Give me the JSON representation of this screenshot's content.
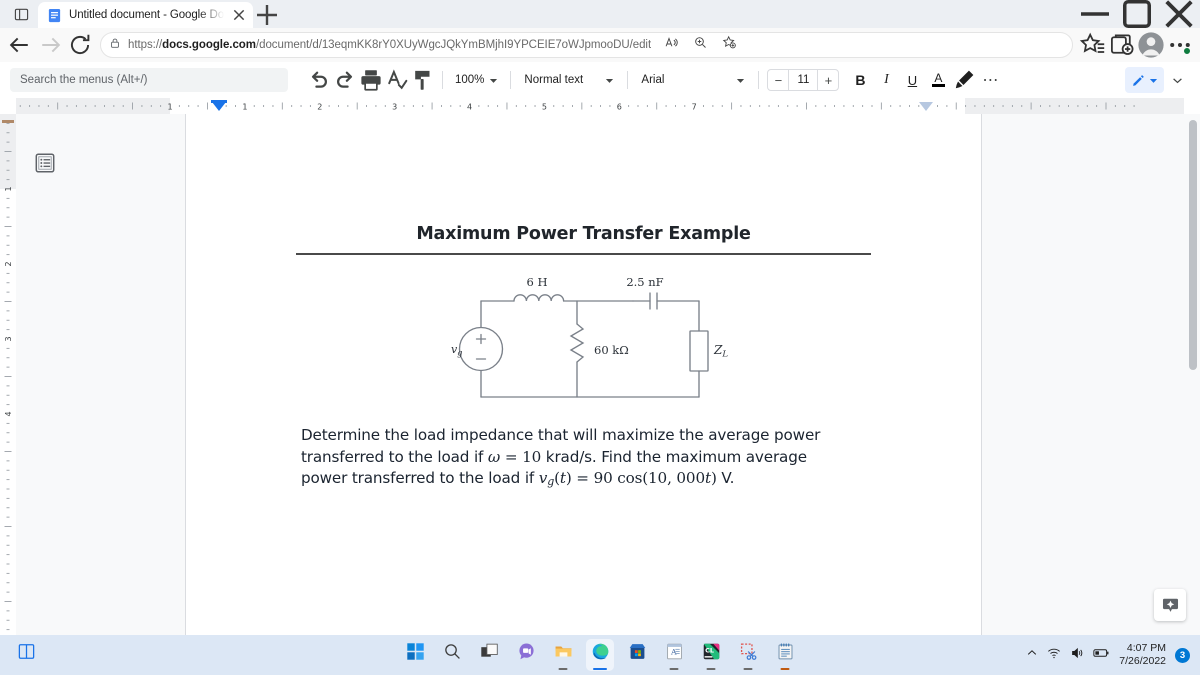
{
  "browser": {
    "tab": {
      "title": "Untitled document - Google Doc",
      "favicon_name": "google-docs-favicon",
      "close_label": "×"
    },
    "newtab_label": "+",
    "window_controls": {
      "minimize": "—",
      "maximize": "⬜",
      "close": "✕"
    },
    "nav": {
      "back": "←",
      "refresh": "↻"
    },
    "url": {
      "scheme": "https://",
      "domain": "docs.google.com",
      "path": "/document/d/13eqmKK8rY0XUyWgcJQkYmBMjhI9YPCEIE7oWJpmooDU/edit",
      "full": "https://docs.google.com/document/d/13eqmKK8rY0XUyWgcJQkYmBMjhI9YPCEIE7oWJpmooDU/edit",
      "lock_icon": "lock-icon"
    },
    "toolbar_icons": [
      "read-aloud-icon",
      "zoom-icon",
      "add-favorite-icon",
      "favorites-icon",
      "collections-icon",
      "profile-icon",
      "settings-more-icon"
    ]
  },
  "docs": {
    "search": {
      "placeholder": "Search the menus (Alt+/)"
    },
    "tools": {
      "undo": "undo-icon",
      "redo": "redo-icon",
      "print": "print-icon",
      "spellcheck": "spellcheck-icon",
      "paint_format": "paint-format-icon"
    },
    "zoom": {
      "value": "100%"
    },
    "paragraph_style": {
      "value": "Normal text"
    },
    "font": {
      "value": "Arial"
    },
    "font_size": {
      "value": "11",
      "decrease": "−",
      "increase": "+"
    },
    "format": {
      "bold": "B",
      "italic": "I",
      "underline": "U",
      "text_color": "A",
      "highlight": "highlight-icon",
      "more": "⋯"
    },
    "editing_mode": {
      "icon": "pencil-icon",
      "caret": "chevron-down-icon"
    },
    "hide_menus": "chevron-up-icon",
    "outline_button": "document-outline-icon",
    "explore_button": "explore-icon",
    "ruler": {
      "h_labels": [
        "1",
        "1",
        "2",
        "3",
        "4",
        "5",
        "6",
        "7"
      ],
      "v_labels": [
        "1",
        "2",
        "3",
        "4"
      ]
    }
  },
  "document": {
    "title": "Maximum Power Transfer Example",
    "problem_lines": [
      {
        "parts": [
          {
            "t": "text",
            "v": "Determine the load impedance that will maximize the average power"
          }
        ]
      },
      {
        "parts": [
          {
            "t": "text",
            "v": "transferred to the load if "
          },
          {
            "t": "it",
            "v": "ω"
          },
          {
            "t": "text",
            "v": " = "
          },
          {
            "t": "rm",
            "v": "10"
          },
          {
            "t": "text",
            "v": " krad/s. Find the maximum average"
          }
        ]
      },
      {
        "parts": [
          {
            "t": "text",
            "v": "power transferred to the load if "
          },
          {
            "t": "it",
            "v": "v"
          },
          {
            "t": "sub",
            "v": "g"
          },
          {
            "t": "rm",
            "v": "("
          },
          {
            "t": "it",
            "v": "t"
          },
          {
            "t": "rm",
            "v": ") = 90 cos(10, 000"
          },
          {
            "t": "it",
            "v": "t"
          },
          {
            "t": "rm",
            "v": ")"
          },
          {
            "t": "text",
            "v": " V."
          }
        ]
      }
    ],
    "problem_text_plain": "Determine the load impedance that will maximize the average power transferred to the load if ω = 10 krad/s. Find the maximum average power transferred to the load if v_g(t) = 90 cos(10,000t) V.",
    "circuit": {
      "type": "schematic",
      "source_label": "v",
      "source_sub": "g",
      "source_plus": "+",
      "source_minus": "−",
      "inductor_label": "6 H",
      "capacitor_label": "2.5 nF",
      "resistor_label": "60 kΩ",
      "load_label": "Z",
      "load_sub": "L",
      "wire_color": "#7a8089"
    }
  },
  "taskbar": {
    "items": [
      {
        "name": "start-button",
        "icon": "windows-logo-icon",
        "running": false
      },
      {
        "name": "search-button",
        "icon": "search-icon",
        "running": false
      },
      {
        "name": "task-view-button",
        "icon": "task-view-icon",
        "running": false
      },
      {
        "name": "chat-button",
        "icon": "chat-icon",
        "running": false
      },
      {
        "name": "file-explorer-button",
        "icon": "folder-icon",
        "running": true
      },
      {
        "name": "edge-button",
        "icon": "edge-icon",
        "running": true,
        "active": true
      },
      {
        "name": "microsoft-store-button",
        "icon": "store-icon",
        "running": false
      },
      {
        "name": "word-button",
        "icon": "document-app-icon",
        "running": true
      },
      {
        "name": "clion-button",
        "icon": "clion-icon",
        "running": true
      },
      {
        "name": "snipping-tool-button",
        "icon": "snipping-tool-icon",
        "running": true
      },
      {
        "name": "notepad-button",
        "icon": "notepad-icon",
        "running": true
      }
    ],
    "tray": {
      "overflow": "chevron-up-icon",
      "wifi": "wifi-icon",
      "volume": "volume-icon",
      "battery": "battery-icon",
      "time": "4:07 PM",
      "date": "7/26/2022",
      "notification_count": "3"
    }
  }
}
